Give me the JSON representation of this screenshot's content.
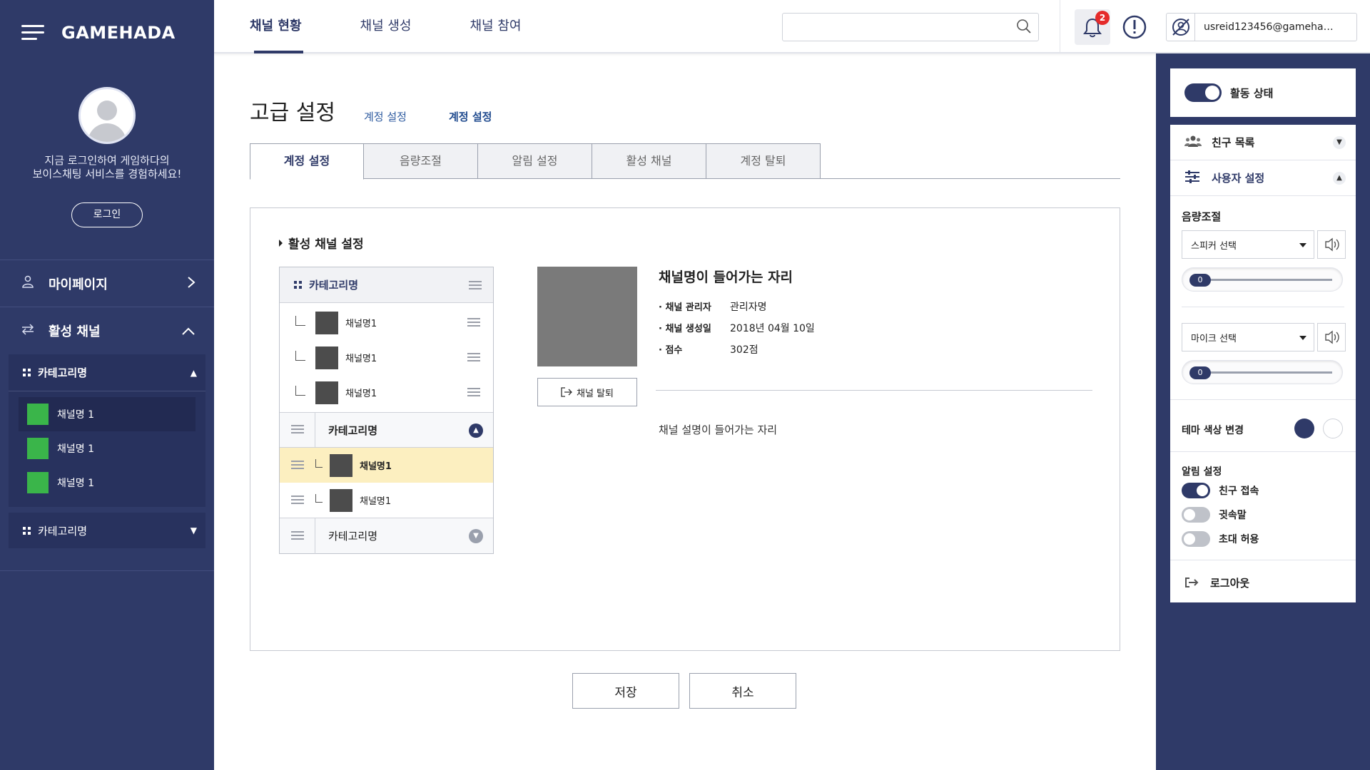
{
  "brand": {
    "name": "GAMEHADA"
  },
  "left": {
    "login_message_line1": "지금 로그인하여 게임하다의",
    "login_message_line2": "보이스채팅 서비스를 경험하세요!",
    "login_button": "로그인",
    "menu": [
      {
        "label": "마이페이지",
        "icon": "user-icon"
      },
      {
        "label": "활성 채널",
        "icon": "swap-icon"
      }
    ],
    "category_open": {
      "name": "카테고리명",
      "channels": [
        "채널명 1",
        "채널명 1",
        "채널명 1"
      ]
    },
    "category_closed": {
      "name": "카테고리명"
    }
  },
  "topbar": {
    "tabs": [
      "채널 현황",
      "채널 생성",
      "채널 참여"
    ],
    "search_placeholder": "",
    "notification_count": "2",
    "user_email": "usreid123456@gamehada..."
  },
  "main": {
    "title": "고급 설정",
    "breadcrumb": [
      "계정 설정",
      "계정 설정"
    ],
    "tabs": [
      "계정 설정",
      "음량조절",
      "알림 설정",
      "활성 채널",
      "계정 탈퇴"
    ],
    "section_title": "활성 채널 설정",
    "tree": {
      "category1": "카테고리명",
      "category1_channels": [
        "채널명1",
        "채널명1",
        "채널명1"
      ],
      "category2": "카테고리명",
      "category2_channels": [
        "채널명1",
        "채널명1"
      ],
      "category3": "카테고리명"
    },
    "channel_detail": {
      "name": "채널명이 들어가는 자리",
      "leave_button": "채널 탈퇴",
      "info": [
        {
          "key": "· 채널 관리자",
          "value": "관리자명"
        },
        {
          "key": "· 채널 생성일",
          "value": "2018년 04월 10일"
        },
        {
          "key": "· 점수",
          "value": "302점"
        }
      ],
      "description": "채널 설명이 들어가는 자리"
    },
    "save_button": "저장",
    "cancel_button": "취소"
  },
  "right": {
    "status_label": "활동 상태",
    "friends_label": "친구 목록",
    "user_settings_label": "사용자 설정",
    "volume_label": "음량조절",
    "speaker_select": "스피커 선택",
    "speaker_level": "0",
    "mic_select": "마이크 선택",
    "mic_level": "0",
    "theme_label": "테마 색상 변경",
    "theme_colors": [
      "#2f3a68",
      "#ffffff"
    ],
    "notify_label": "알림 설정",
    "notify_items": [
      {
        "label": "친구 접속",
        "on": true
      },
      {
        "label": "귓속말",
        "on": false
      },
      {
        "label": "초대 허용",
        "on": false
      }
    ],
    "logout_label": "로그아웃"
  }
}
